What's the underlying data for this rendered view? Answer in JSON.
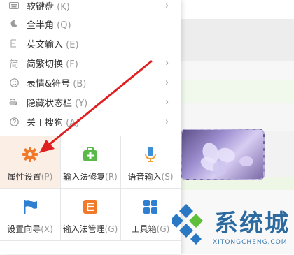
{
  "menu": {
    "items": [
      {
        "label": "软键盘",
        "key": "(K)",
        "icon": "keyboard-icon"
      },
      {
        "label": "全半角",
        "key": "(Q)",
        "icon": "moon-icon"
      },
      {
        "label": "英文输入",
        "key": "(E)",
        "icon": "letter-e-icon"
      },
      {
        "label": "简繁切换",
        "key": "(F)",
        "icon": "jian-char-icon"
      },
      {
        "label": "表情&符号",
        "key": "(B)",
        "icon": "smile-icon"
      },
      {
        "label": "隐藏状态栏",
        "key": "(Y)",
        "icon": "hide-bar-icon"
      },
      {
        "label": "关于搜狗",
        "key": "(A)",
        "icon": "help-icon"
      }
    ],
    "tools": [
      {
        "label": "属性设置",
        "key": "(P)",
        "icon": "gear-icon",
        "color": "#f07a2a"
      },
      {
        "label": "输入法修复",
        "key": "(R)",
        "icon": "repair-kit-icon",
        "color": "#5bb94a"
      },
      {
        "label": "语音输入",
        "key": "(S)",
        "icon": "microphone-icon",
        "color": "#3f8fd8"
      },
      {
        "label": "设置向导",
        "key": "(X)",
        "icon": "flag-icon",
        "color": "#2f7fd0"
      },
      {
        "label": "输入法管理",
        "key": "(G)",
        "icon": "manage-icon",
        "color": "#f07a2a"
      },
      {
        "label": "工具箱",
        "key": "(G)",
        "icon": "toolbox-icon",
        "color": "#2f7fd0"
      }
    ]
  },
  "watermark": {
    "title": "系统城",
    "url": "XITONGCHENG.COM"
  },
  "colors": {
    "arrow": "#e02020",
    "active_cell": "#fbeee4"
  }
}
